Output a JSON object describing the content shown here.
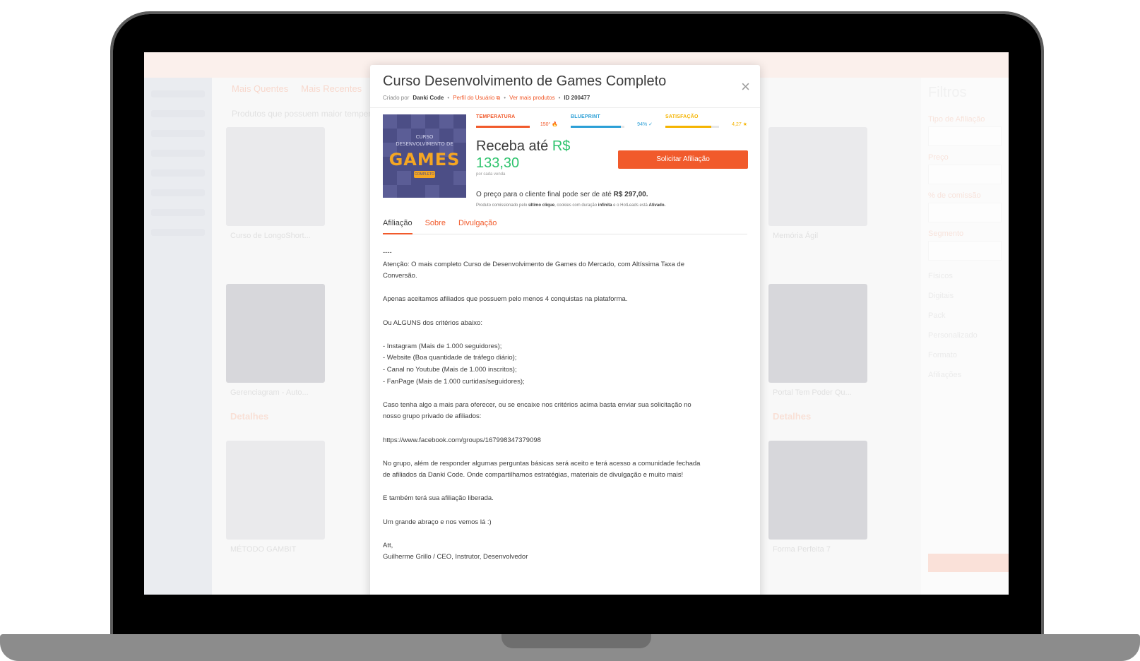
{
  "modal": {
    "title": "Curso Desenvolvimento de Games Completo",
    "close_glyph": "×",
    "meta": {
      "created_by_prefix": "Criado por",
      "creator": "Danki Code",
      "profile_link": "Perfil do Usuário",
      "more_products_link": "Ver mais produtos",
      "id_text": "ID 200477",
      "bullet": "•"
    },
    "cover": {
      "small_top": "CURSO",
      "small_mid": "DESENVOLVIMENTO DE",
      "big": "GAMES",
      "badge": "COMPLETO"
    },
    "metrics": [
      {
        "label": "TEMPERATURA",
        "value": "150° 🔥",
        "fill": 1.0,
        "color": "#f15a2b"
      },
      {
        "label": "BLUEPRINT",
        "value": "94% ✓",
        "fill": 0.94,
        "color": "#2b9fd6"
      },
      {
        "label": "SATISFAÇÃO",
        "value": "4,27 ★",
        "fill": 0.85,
        "color": "#f5b400"
      }
    ],
    "earn": {
      "prefix": "Receba até",
      "currency": "R$",
      "amount": "133,30",
      "per_sale": "por cada venda"
    },
    "affiliate_button": "Solicitar Afiliação",
    "price_line": {
      "text": "O preço para o cliente final pode ser de até",
      "value": "R$ 297,00."
    },
    "note": {
      "a": "Produto comissionado pelo",
      "b": "último clique",
      "c": ", cookies com duração",
      "d": "infinita",
      "e": "e o HotLeads está",
      "f": "Ativado."
    },
    "tabs": [
      "Afiliação",
      "Sobre",
      "Divulgação"
    ],
    "content": {
      "l01": "----",
      "l02": "Atenção: O mais completo Curso de Desenvolvimento de Games do Mercado, com Altíssima Taxa de",
      "l03": "Conversão.",
      "l04": "Apenas aceitamos afiliados que possuem pelo menos 4 conquistas na plataforma.",
      "l05": "Ou ALGUNS dos critérios abaixo:",
      "l06": "- Instagram (Mais de 1.000 seguidores);",
      "l07": "- Website (Boa quantidade de tráfego diário);",
      "l08": "- Canal no Youtube (Mais de 1.000 inscritos);",
      "l09": "- FanPage (Mais de 1.000 curtidas/seguidores);",
      "l10": "Caso tenha algo a mais para oferecer, ou se encaixe nos critérios acima basta enviar sua solicitação no",
      "l11": "nosso grupo privado de afiliados:",
      "l12": "https://www.facebook.com/groups/167998347379098",
      "l13": "No grupo, além de responder algumas perguntas básicas será aceito e terá acesso a comunidade fechada",
      "l14": "de afiliados da Danki Code. Onde compartilhamos estratégias, materiais de divulgação e muito mais!",
      "l15": "E também terá sua afiliação liberada.",
      "l16": "Um grande abraço e nos vemos lá :)",
      "l17": "Att,",
      "l18": "Guilherme Grillo / CEO, Instrutor, Desenvolvedor"
    }
  },
  "background": {
    "tabs": [
      "Mais Quentes",
      "Mais Recentes"
    ],
    "subtitle": "Produtos que possuem maior temperatura",
    "filters_title": "Filtros",
    "filter_labels": [
      "Tipo de Afiliação",
      "Preço",
      "% de comissão",
      "Segmento"
    ],
    "filter_checks": [
      "Físicos",
      "Digitais",
      "Pack",
      "Personalizado",
      "Formato",
      "Afiliações"
    ],
    "card_titles": [
      "Curso de LongoShort...",
      "Memória Ágil",
      "Gerenciagram - Auto...",
      "Portal Tem Poder Qu...",
      "MÉTODO GAMBIT",
      "Forma Perfeita 7"
    ],
    "card_link": "Detalhes"
  },
  "colors": {
    "accent": "#f15a2b",
    "green": "#2ec36d",
    "text": "#3c3c3c"
  }
}
